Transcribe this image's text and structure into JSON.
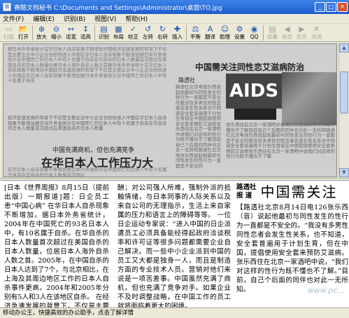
{
  "window": {
    "title": "赛酷文档秘书 C:\\Documents and Settings\\Administrator\\桌面\\TO.jpg"
  },
  "menu": [
    "文件(F)",
    "编辑(E)",
    "识别(B)",
    "视图(V)",
    "帮助(H)"
  ],
  "toolbar": [
    {
      "label": "扫描",
      "icon": "scanner-icon",
      "glyph": "▭",
      "enabled": false
    },
    {
      "label": "打开",
      "icon": "open-folder-icon",
      "glyph": "📂",
      "enabled": true
    },
    {
      "label": "放大",
      "icon": "zoom-in-icon",
      "glyph": "⊕",
      "enabled": true
    },
    {
      "label": "缩小",
      "icon": "zoom-out-icon",
      "glyph": "⊖",
      "enabled": true
    },
    {
      "label": "适宽",
      "icon": "fit-width-icon",
      "glyph": "↔",
      "enabled": true
    },
    {
      "label": "适高",
      "icon": "fit-height-icon",
      "glyph": "↕",
      "enabled": true
    },
    {
      "label": "识别",
      "icon": "recognize-icon",
      "glyph": "▤",
      "enabled": true
    },
    {
      "label": "布局",
      "icon": "layout-icon",
      "glyph": "▦",
      "enabled": true
    },
    {
      "label": "校正",
      "icon": "correct-icon",
      "glyph": "✓",
      "enabled": true
    },
    {
      "label": "左转",
      "icon": "rotate-left-icon",
      "glyph": "↺",
      "enabled": true
    },
    {
      "label": "右转",
      "icon": "rotate-right-icon",
      "glyph": "↻",
      "enabled": true
    },
    {
      "label": "插入",
      "icon": "insert-icon",
      "glyph": "✚",
      "enabled": true
    },
    {
      "label": "平衡",
      "icon": "balance-icon",
      "glyph": "⚖",
      "enabled": true
    },
    {
      "label": "翻译",
      "icon": "translate-icon",
      "glyph": "A",
      "enabled": true
    },
    {
      "label": "助理",
      "icon": "assistant-icon",
      "glyph": "☺",
      "enabled": true
    },
    {
      "label": "设置",
      "icon": "settings-icon",
      "glyph": "⚙",
      "enabled": true
    },
    {
      "label": "QQ",
      "icon": "qq-icon",
      "glyph": "◉",
      "enabled": true
    },
    {
      "label": "批量",
      "icon": "batch-icon",
      "glyph": "▤",
      "enabled": false
    },
    {
      "label": "前页",
      "icon": "prev-page-icon",
      "glyph": "◀",
      "enabled": false
    },
    {
      "label": "后页",
      "icon": "next-page-icon",
      "glyph": "▶",
      "enabled": false
    },
    {
      "label": "关闭",
      "icon": "close-doc-icon",
      "glyph": "✕",
      "enabled": false
    }
  ],
  "scan_image": {
    "headline_left": "在华日本人工作压力大",
    "subhead_left": "中国充满商机，但也充满竞争",
    "headline_right": "中国需关注同性恋艾滋病防治",
    "aids_label": "AIDS",
    "byline": "路透社"
  },
  "text": {
    "col1": "[日本《世界周报》8月15日（提前出版）一期报道]题：日企员工患“中国心病”    在华日本人自杀现象不断增加。据日本外务省统计，2004年在中国死亡的93名日本人中，有10名属于自杀。在华自杀的日本人数量首次超过在美国自杀的日本人数量，位居日本人海外自杀人数之首。2005年，在中国自杀的日本人达到了7个，与北京相比，在上海及其周边地区工作的日本人自杀事件更高。2004年和2005年分别有5人和3人在该地区自杀。    在经济急速发展的背景下，不仅是主要企业，中小企业也纷纷进入中国，",
    "col2": "酬；对公司强人所难，强制外派的抵触情绪，与日本同事的人际关系以及来自公司的无理指示，生活上来自家属的压力和语言上的障碍等等。    一位日企运动专家说：“进入中国的日企派遣员工必须具备能经得起政府洽谈税率和许可证等很多问题都需要企业自己解决。而一些中小企业派到中国的员工又大都是独身一人，而且是制造方面的专业技术人员。营销对他们来说是一项苦差事。中国虽然充满了商机，但也充满了竞争对手。如果企业不及时调整战略，在中国工作的员工就将面临着更大的困境。",
    "col3_small_top": "路透社",
    "col3_small_bottom": "报  道",
    "col3_headline": "中国需关注",
    "col3_body": "【路透社北京8月14日电126张乐西（音）说起他最初与同性发生的性行为一直都是不安全的。“我没有多男性同性恋者会发生性关系，也不知道，安全套普遍用于计划生育，但在中国，提倡使用安全套来预防艾滋病。    张乐西住在北京一家酒吧中说，“我们对这样的性行为既不懂也不了解。”目前，自己个后面的同伴也对此一无所知。"
  },
  "status": "移动办公王，快捷高效的办公助手，点击了解详情",
  "watermark": "www.pc..."
}
